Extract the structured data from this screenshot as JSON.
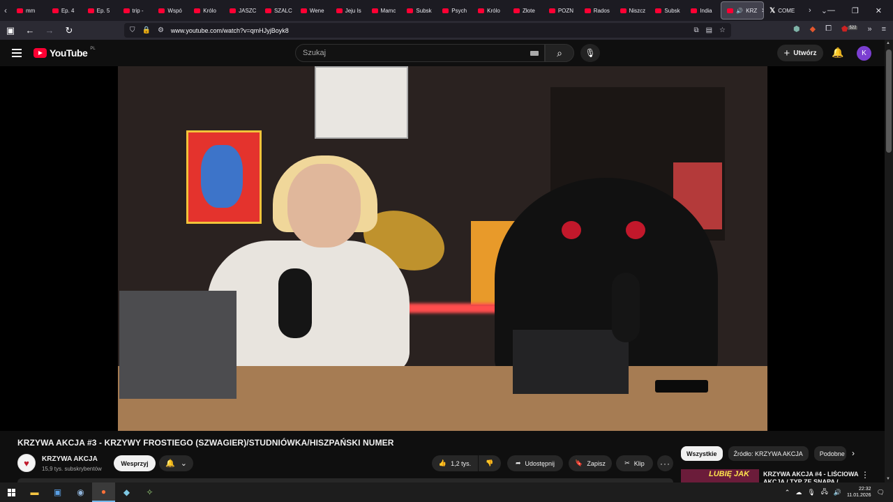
{
  "browser": {
    "tabs": [
      {
        "label": "mm",
        "icon": "youtube-icon"
      },
      {
        "label": "Ep. 4",
        "icon": "youtube-icon"
      },
      {
        "label": "Ep. 5",
        "icon": "youtube-icon"
      },
      {
        "label": "trip -",
        "icon": "youtube-icon"
      },
      {
        "label": "Wspó",
        "icon": "youtube-icon"
      },
      {
        "label": "Królo",
        "icon": "youtube-icon"
      },
      {
        "label": "JASZC",
        "icon": "youtube-icon"
      },
      {
        "label": "SZALC",
        "icon": "youtube-icon"
      },
      {
        "label": "Wene",
        "icon": "youtube-icon"
      },
      {
        "label": "Jeju Is",
        "icon": "youtube-icon"
      },
      {
        "label": "Mamc",
        "icon": "youtube-icon"
      },
      {
        "label": "Subsk",
        "icon": "youtube-icon"
      },
      {
        "label": "Psych",
        "icon": "youtube-icon"
      },
      {
        "label": "Królo",
        "icon": "youtube-icon"
      },
      {
        "label": "Złote",
        "icon": "youtube-icon"
      },
      {
        "label": "POZN",
        "icon": "youtube-icon"
      },
      {
        "label": "Rados",
        "icon": "youtube-icon"
      },
      {
        "label": "Niszcz",
        "icon": "youtube-icon"
      },
      {
        "label": "Subsk",
        "icon": "youtube-icon"
      },
      {
        "label": "India",
        "icon": "youtube-icon"
      }
    ],
    "active_tab": {
      "label": "KRZ",
      "icon": "youtube-icon"
    },
    "x_tab": {
      "label": "COME"
    },
    "url": "www.youtube.com/watch?v=qmHJyjBoyk8",
    "extension_badge": "522"
  },
  "youtube": {
    "logo_text": "YouTube",
    "country_code": "PL",
    "search_placeholder": "Szukaj",
    "create_label": "Utwórz",
    "avatar_letter": "K"
  },
  "video": {
    "title": "KRZYWA AKCJA #3 - KRZYWY FROSTIEGO (SZWAGIER)/STUDNIÓWKA/HISZPAŃSKI NUMER",
    "channel_name": "KRZYWA AKCJA",
    "subscribers": "15,9 tys. subskrybentów",
    "support_label": "Wesprzyj",
    "likes": "1,2 tys.",
    "share_label": "Udostępnij",
    "save_label": "Zapisz",
    "clip_label": "Klip"
  },
  "sidebar": {
    "chips": [
      "Wszystkie",
      "Źródło: KRZYWA AKCJA",
      "Podobne"
    ],
    "recommendation": {
      "title": "KRZYWA AKCJA #4 - LIŚCIOWA AKCJA / TYP ZE SNAPA /",
      "thumb_text": "LUBIĘ JAK"
    }
  },
  "taskbar": {
    "time": "22:32",
    "date": "11.01.2026"
  }
}
